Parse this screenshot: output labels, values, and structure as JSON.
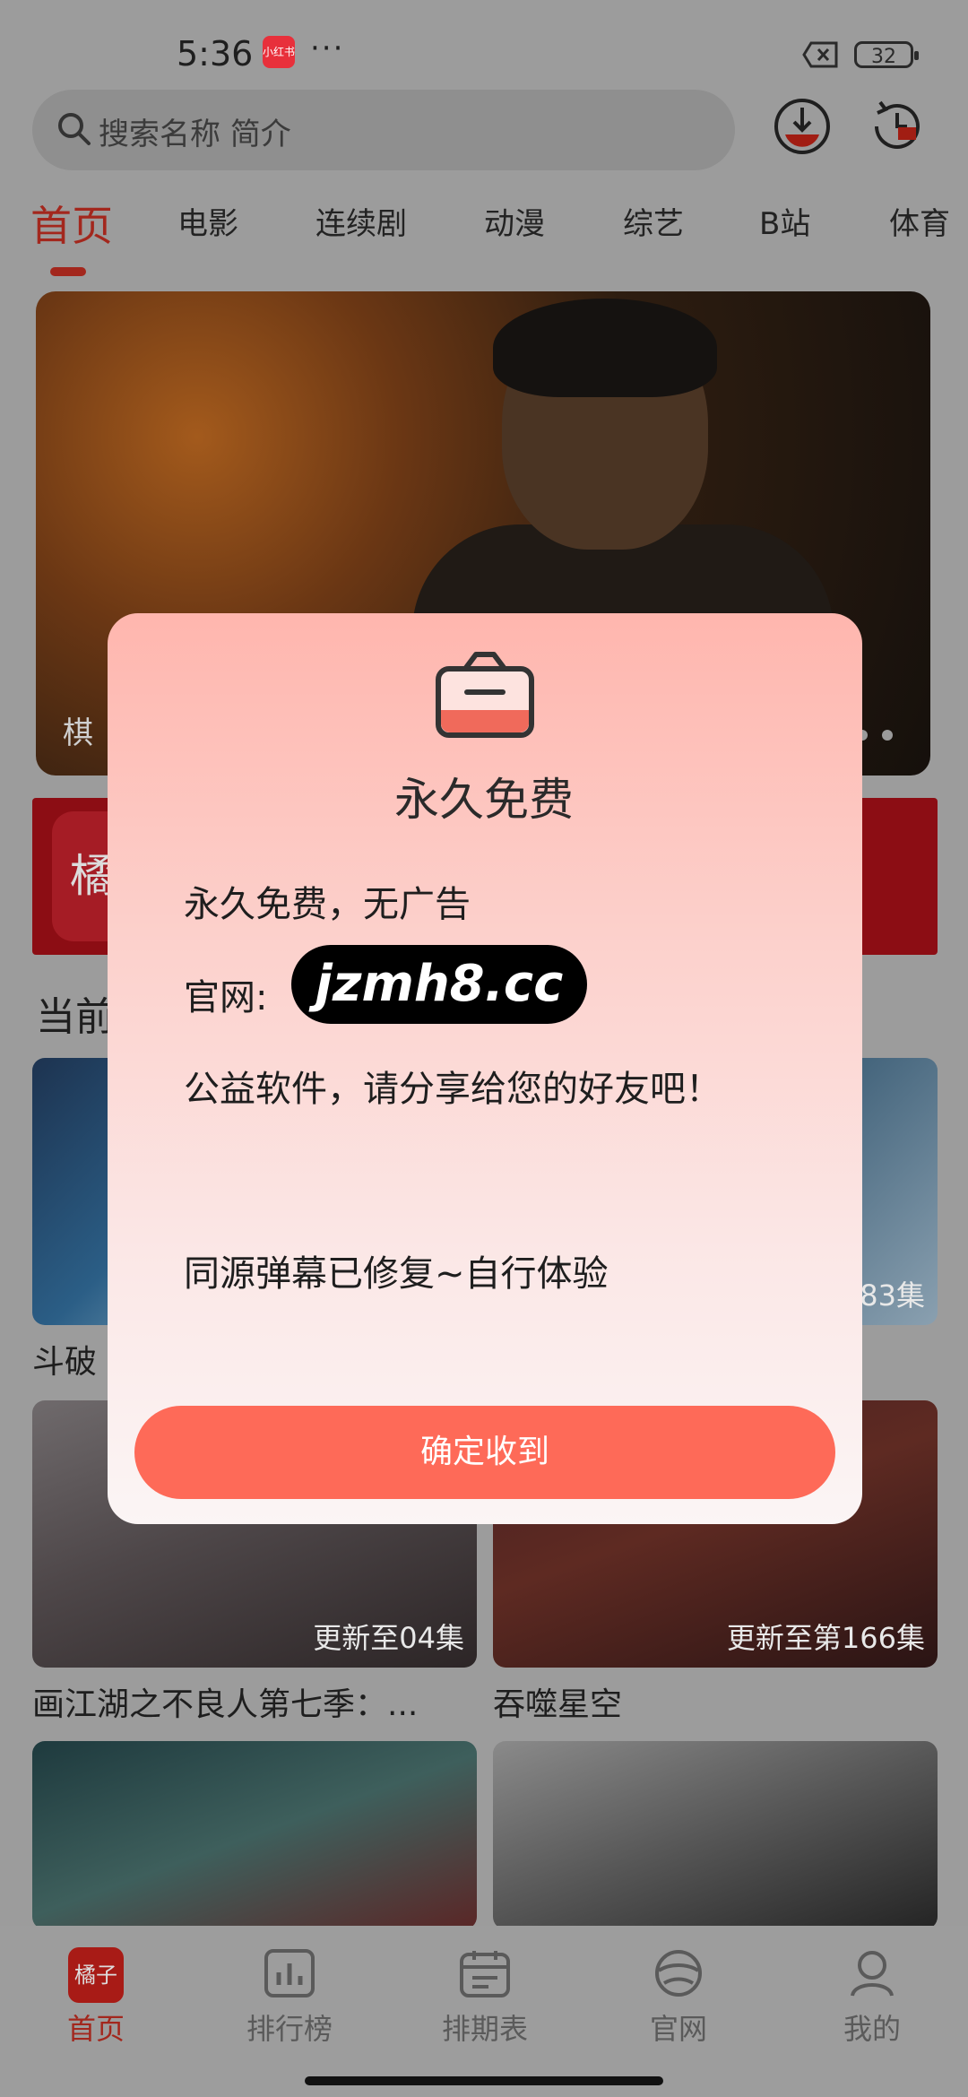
{
  "status_bar": {
    "time": "5:36",
    "app_badge": "小红书",
    "more": "···",
    "battery": "32"
  },
  "search": {
    "placeholder": "搜索名称 简介"
  },
  "tabs": [
    {
      "label": "首页"
    },
    {
      "label": "电影"
    },
    {
      "label": "连续剧"
    },
    {
      "label": "动漫"
    },
    {
      "label": "综艺"
    },
    {
      "label": "B站"
    },
    {
      "label": "体育"
    }
  ],
  "hero": {
    "caption": "棋"
  },
  "promo": {
    "badge_text": "橘"
  },
  "section": {
    "title": "当前"
  },
  "cards": [
    {
      "title": "斗破",
      "badge": ""
    },
    {
      "title": "",
      "badge": "83集"
    },
    {
      "title": "画江湖之不良人第七季：...",
      "badge": "更新至04集"
    },
    {
      "title": "吞噬星空",
      "badge": "更新至第166集"
    },
    {
      "title": "",
      "badge": ""
    },
    {
      "title": "",
      "badge": ""
    }
  ],
  "bottom_nav": [
    {
      "label": "首页",
      "icon": "橘子"
    },
    {
      "label": "排行榜"
    },
    {
      "label": "排期表"
    },
    {
      "label": "官网"
    },
    {
      "label": "我的"
    }
  ],
  "dialog": {
    "title": "永久免费",
    "line1": "永久免费，无广告",
    "url_label": "官网:",
    "url": "jzmh8.cc",
    "line3": "公益软件，请分享给您的好友吧！",
    "line4": "同源弹幕已修复~自行体验",
    "confirm_label": "确定收到"
  },
  "colors": {
    "accent": "#a3271d",
    "dialog_button": "#fe6a58"
  }
}
